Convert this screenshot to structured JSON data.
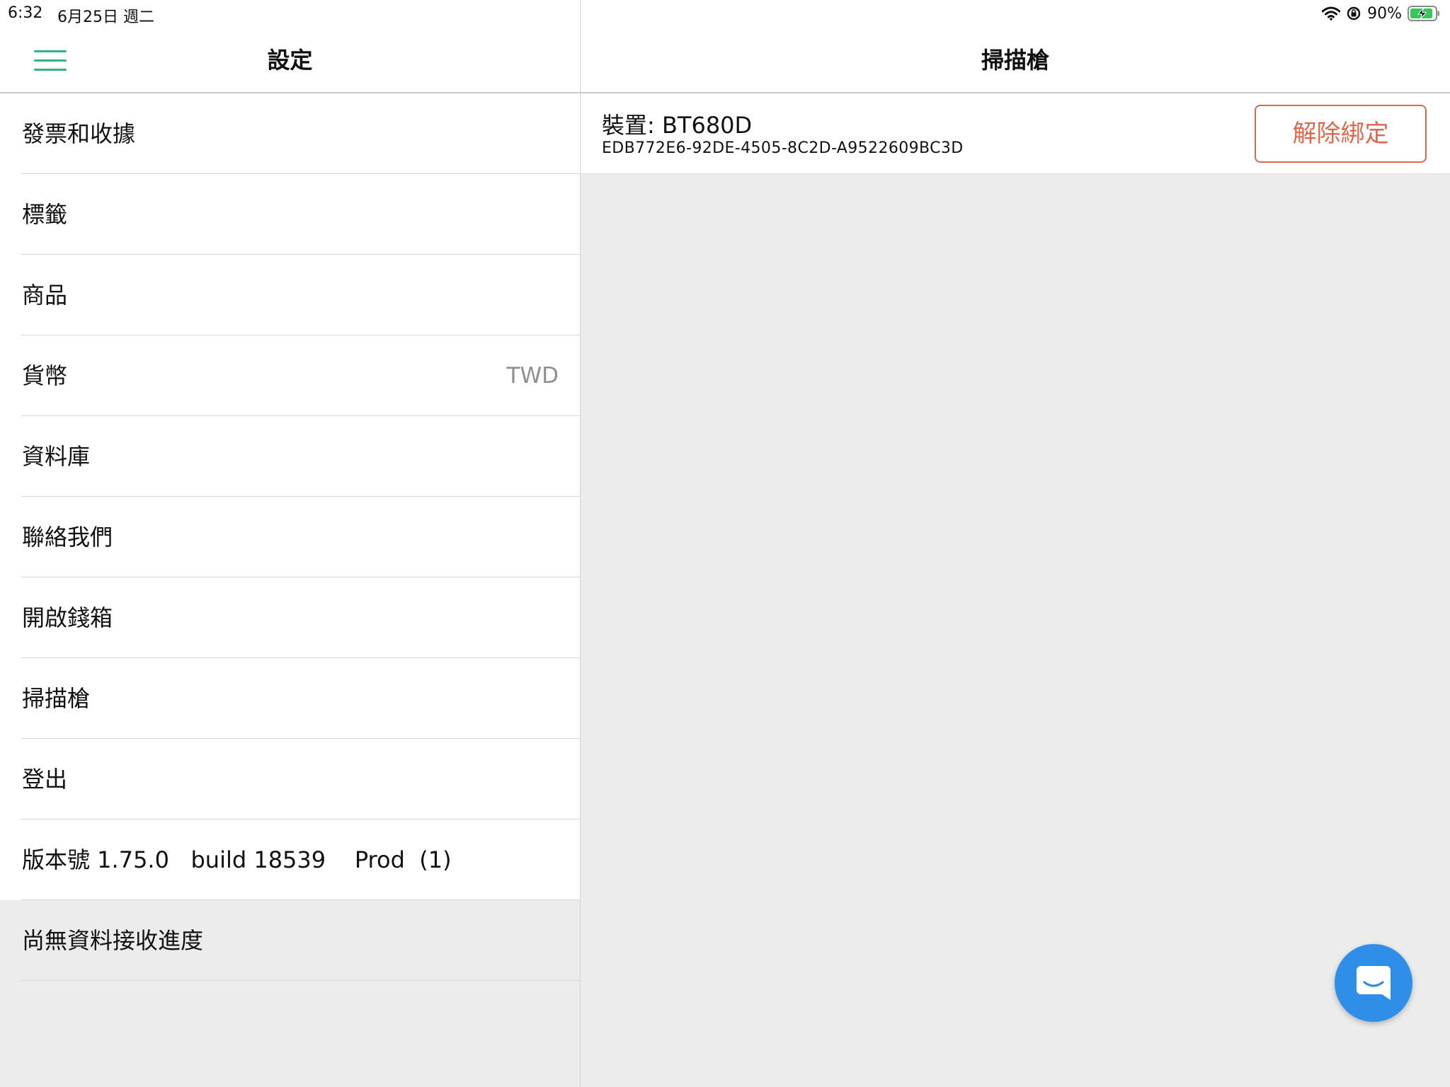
{
  "status_bar": {
    "time": "6:32",
    "date": "6月25日 週二",
    "battery_percent": "90%",
    "icons": [
      "wifi-icon",
      "rotation-lock-icon",
      "battery-charging-icon"
    ]
  },
  "sidebar": {
    "title": "設定",
    "menu_icon": "hamburger-menu-icon",
    "items": [
      {
        "label": "發票和收據"
      },
      {
        "label": "標籤"
      },
      {
        "label": "商品"
      },
      {
        "label": "貨幣",
        "value": "TWD"
      },
      {
        "label": "資料庫"
      },
      {
        "label": "聯絡我們"
      },
      {
        "label": "開啟錢箱"
      },
      {
        "label": "掃描槍"
      },
      {
        "label": "登出"
      },
      {
        "label": "版本號 1.75.0   build 18539    Prod  (1)"
      }
    ],
    "sync_status": "尚無資料接收進度"
  },
  "detail": {
    "title": "掃描槍",
    "device": {
      "name": "裝置: BT680D",
      "uuid": "EDB772E6-92DE-4505-8C2D-A9522609BC3D",
      "unbind_label": "解除綁定"
    }
  },
  "chat_button": {
    "icon": "chat-bubble-icon"
  },
  "colors": {
    "accent_green": "#2fb38a",
    "destructive_orange": "#d9684d",
    "chat_blue": "#2f8fe8",
    "background_gray": "#ececec",
    "secondary_text": "#8e8e93"
  }
}
